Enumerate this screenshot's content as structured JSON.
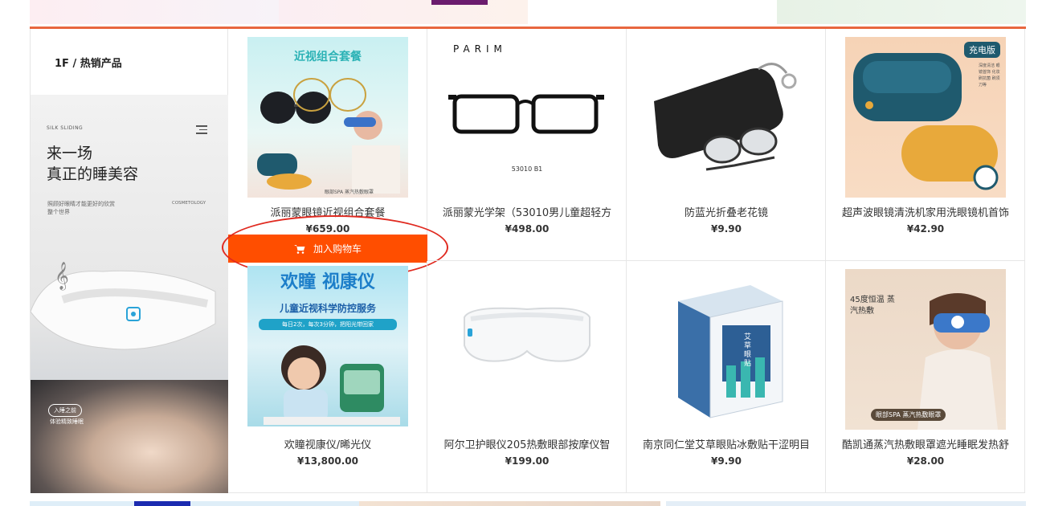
{
  "floor": {
    "title": "1F / 热销产品",
    "accent_color": "#e8673f"
  },
  "promo": {
    "brand_en": "SILK SLIDING",
    "headline_line1": "来一场",
    "headline_line2": "真正的睡美容",
    "subtext": "照顾好眼睛才能更好的欣赏整个世界",
    "cosmetology": "COSMETOLOGY",
    "pill": "入睡之前",
    "pill_sub": "体验精致睡眠"
  },
  "products": [
    {
      "name": "派丽蒙眼镜近视组合套餐",
      "price": "¥659.00",
      "image_text": "近视组合套餐",
      "image_badge": "眼部SPA 蒸汽热敷眼罩"
    },
    {
      "name": "派丽蒙光学架（53010男儿童超轻方",
      "price": "¥498.00",
      "image_text": "PARIM",
      "image_badge": "53010 B1"
    },
    {
      "name": "防蓝光折叠老花镜",
      "price": "¥9.90"
    },
    {
      "name": "超声波眼镜清洗机家用洗眼镜机首饰",
      "price": "¥42.90",
      "image_text": "充电版",
      "image_badge": "深度清洁 眼镜首饰 化妆刷抗菌 刷须刀等"
    },
    {
      "name": "欢瞳视康仪/晞光仪",
      "price": "¥13,800.00",
      "image_text": "欢瞳 视康仪",
      "image_sub": "儿童近视科学防控服务",
      "image_badge": "每日2次，每次3分钟，把阳光带回家"
    },
    {
      "name": "阿尔卫护眼仪205热敷眼部按摩仪智",
      "price": "¥199.00"
    },
    {
      "name": "南京同仁堂艾草眼贴冰敷贴干涩明目",
      "price": "¥9.90",
      "image_text": "艾草眼贴"
    },
    {
      "name": "酷凯通蒸汽热敷眼罩遮光睡眠发热舒",
      "price": "¥28.00",
      "image_text": "45度恒温 蒸汽热敷",
      "image_badge": "眼部SPA 蒸汽热敷眼罩"
    }
  ],
  "cart_button": {
    "label": "加入购物车",
    "icon": "shopping-cart-icon",
    "color": "#ff4e00"
  },
  "annotation": {
    "color": "#e0291f"
  }
}
